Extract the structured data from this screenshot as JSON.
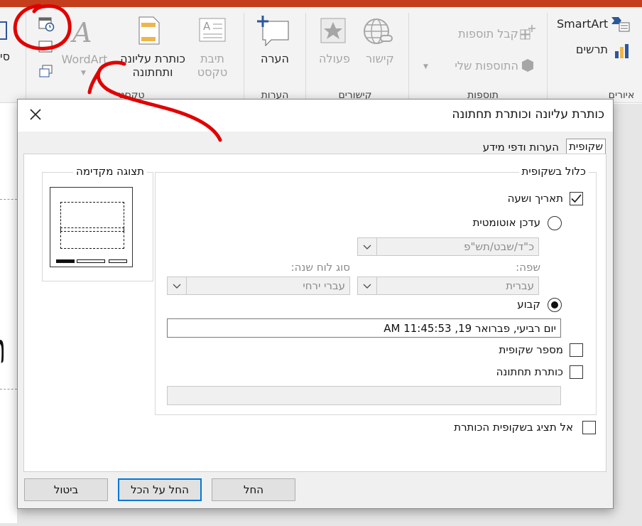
{
  "ribbon": {
    "buttons": {
      "header_footer": "כותרת עליונה ותחתונה",
      "text_box": "תיבת טקסט",
      "wordart": "WordArt",
      "comment": "הערה",
      "action": "פעולה",
      "link": "קישור",
      "get_addins": "קבל תוספות",
      "my_addins": "התוספות שלי",
      "smartart": "SmartArt",
      "charts": "תרשים",
      "partial_left": "סי"
    },
    "groups": {
      "text": "טקסט",
      "comments": "הערות",
      "links": "קישורים",
      "addins": "תוספות",
      "illustrations": "איורים"
    }
  },
  "dialog": {
    "title": "כותרת עליונה וכותרת תחתונה",
    "tabs": [
      {
        "label": "שקופית",
        "active": true
      },
      {
        "label": "הערות ודפי מידע",
        "active": false
      }
    ],
    "include_group_title": "כלול בשקופית",
    "date_time": {
      "label": "תאריך ושעה",
      "checked": true
    },
    "update_auto": {
      "label": "עדכן אוטומטית",
      "selected": false
    },
    "date_format": {
      "value": "כ\"ד/שבט/תש\"פ",
      "enabled": false
    },
    "language": {
      "label": "שפה:",
      "value": "עברית",
      "enabled": false
    },
    "calendar": {
      "label": "סוג לוח שנה:",
      "value": "עברי ירחי",
      "enabled": false
    },
    "fixed": {
      "label": "קבוע",
      "selected": true,
      "value": "יום רביעי, פברואר 19, 11:45:53 AM"
    },
    "slide_number": {
      "label": "מספר שקופית",
      "checked": false
    },
    "footer": {
      "label": "כותרת תחתונה",
      "checked": false,
      "value": ""
    },
    "dont_show_title": {
      "label": "אל תציג בשקופית הכותרת",
      "checked": false
    },
    "preview_title": "תצוגה מקדימה",
    "buttons": {
      "apply": "החל",
      "apply_all": "החל על הכל",
      "cancel": "ביטול"
    }
  },
  "slide": {
    "partial_text": "ת"
  },
  "colors": {
    "accent": "#c43e1c",
    "annotation": "#e00000",
    "focus": "#0078d7"
  }
}
